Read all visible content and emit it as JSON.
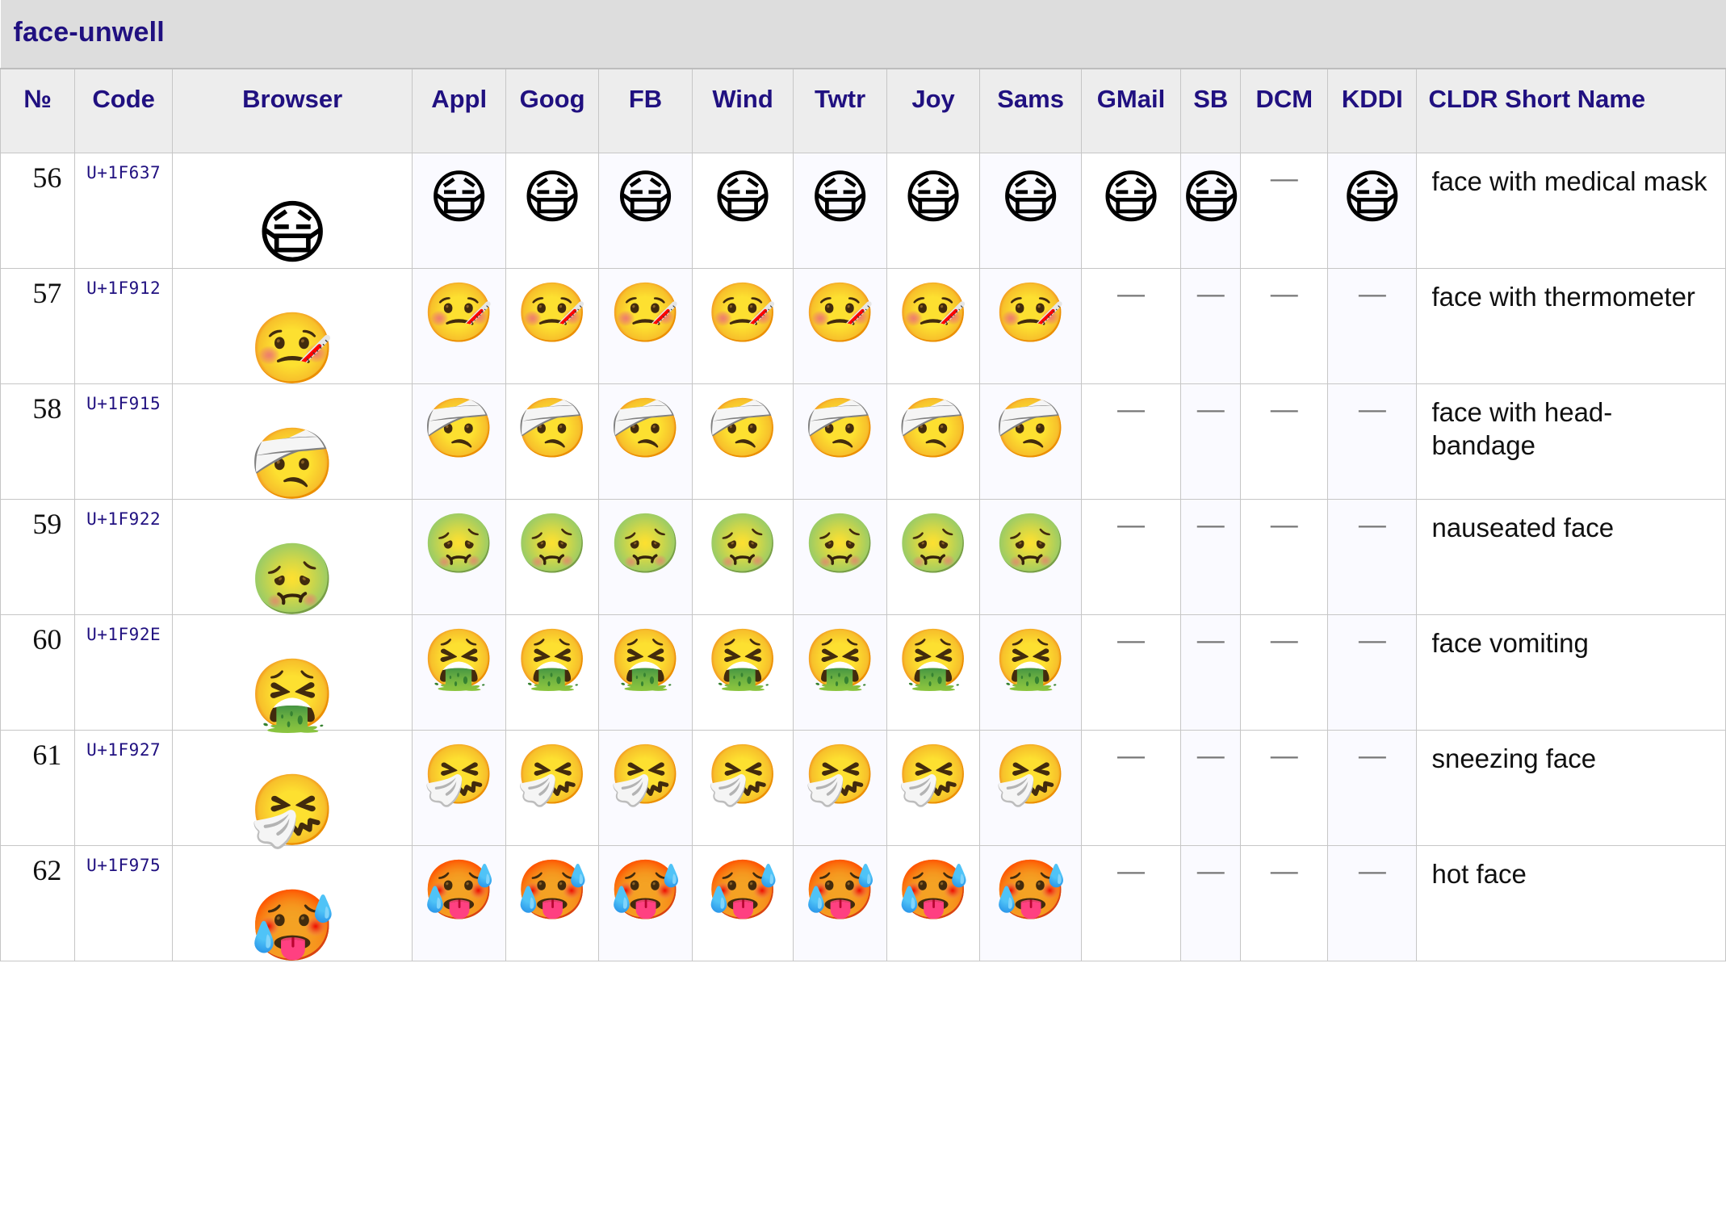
{
  "section": {
    "title": "face-unwell"
  },
  "colors": {
    "header_text": "#201080",
    "header_bg": "#ededed",
    "section_bg": "#dddddd",
    "border": "#c6c6c6",
    "vendor_cell_bg": "#fafaff",
    "missing_dash": "#777777"
  },
  "columns": [
    {
      "key": "num",
      "label": "№"
    },
    {
      "key": "code",
      "label": "Code"
    },
    {
      "key": "browser",
      "label": "Browser"
    },
    {
      "key": "appl",
      "label": "Appl"
    },
    {
      "key": "goog",
      "label": "Goog"
    },
    {
      "key": "fb",
      "label": "FB"
    },
    {
      "key": "wind",
      "label": "Wind"
    },
    {
      "key": "twtr",
      "label": "Twtr"
    },
    {
      "key": "joy",
      "label": "Joy"
    },
    {
      "key": "sams",
      "label": "Sams"
    },
    {
      "key": "gmail",
      "label": "GMail"
    },
    {
      "key": "sb",
      "label": "SB"
    },
    {
      "key": "dcm",
      "label": "DCM"
    },
    {
      "key": "kddi",
      "label": "KDDI"
    },
    {
      "key": "name",
      "label": "CLDR Short Name"
    }
  ],
  "missing_glyph": "—",
  "rows": [
    {
      "num": "56",
      "code": "U+1F637",
      "browser": "😷",
      "appl": "😷",
      "goog": "😷",
      "fb": "😷",
      "wind": "😷",
      "twtr": "😷",
      "joy": "😷",
      "sams": "😷",
      "gmail": "😷",
      "sb": "😷",
      "dcm": "—",
      "kddi": "😷",
      "name": "face with medical mask"
    },
    {
      "num": "57",
      "code": "U+1F912",
      "browser": "🤒",
      "appl": "🤒",
      "goog": "🤒",
      "fb": "🤒",
      "wind": "🤒",
      "twtr": "🤒",
      "joy": "🤒",
      "sams": "🤒",
      "gmail": "—",
      "sb": "—",
      "dcm": "—",
      "kddi": "—",
      "name": "face with thermometer"
    },
    {
      "num": "58",
      "code": "U+1F915",
      "browser": "🤕",
      "appl": "🤕",
      "goog": "🤕",
      "fb": "🤕",
      "wind": "🤕",
      "twtr": "🤕",
      "joy": "🤕",
      "sams": "🤕",
      "gmail": "—",
      "sb": "—",
      "dcm": "—",
      "kddi": "—",
      "name": "face with head-bandage"
    },
    {
      "num": "59",
      "code": "U+1F922",
      "browser": "🤢",
      "appl": "🤢",
      "goog": "🤢",
      "fb": "🤢",
      "wind": "🤢",
      "twtr": "🤢",
      "joy": "🤢",
      "sams": "🤢",
      "gmail": "—",
      "sb": "—",
      "dcm": "—",
      "kddi": "—",
      "name": "nauseated face"
    },
    {
      "num": "60",
      "code": "U+1F92E",
      "browser": "🤮",
      "appl": "🤮",
      "goog": "🤮",
      "fb": "🤮",
      "wind": "🤮",
      "twtr": "🤮",
      "joy": "🤮",
      "sams": "🤮",
      "gmail": "—",
      "sb": "—",
      "dcm": "—",
      "kddi": "—",
      "name": "face vomiting"
    },
    {
      "num": "61",
      "code": "U+1F927",
      "browser": "🤧",
      "appl": "🤧",
      "goog": "🤧",
      "fb": "🤧",
      "wind": "🤧",
      "twtr": "🤧",
      "joy": "🤧",
      "sams": "🤧",
      "gmail": "—",
      "sb": "—",
      "dcm": "—",
      "kddi": "—",
      "name": "sneezing face"
    },
    {
      "num": "62",
      "code": "U+1F975",
      "browser": "🥵",
      "appl": "🥵",
      "goog": "🥵",
      "fb": "🥵",
      "wind": "🥵",
      "twtr": "🥵",
      "joy": "🥵",
      "sams": "🥵",
      "gmail": "—",
      "sb": "—",
      "dcm": "—",
      "kddi": "—",
      "name": "hot face"
    }
  ]
}
